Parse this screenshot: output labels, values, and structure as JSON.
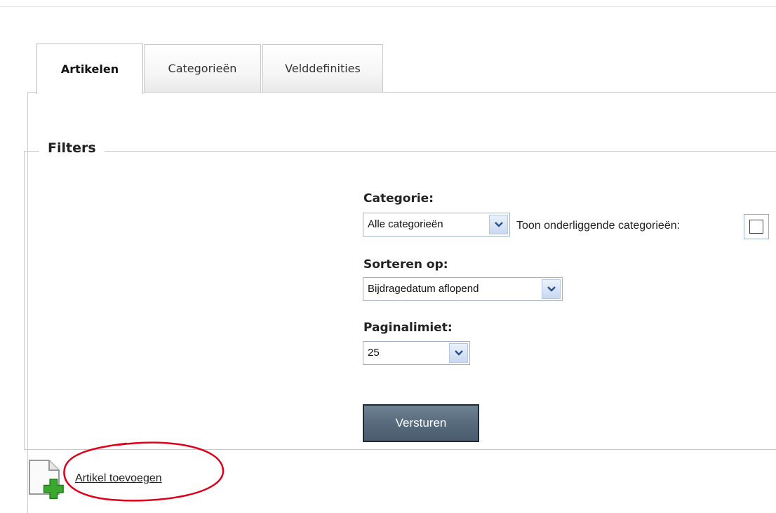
{
  "tabs": [
    {
      "label": "Artikelen",
      "active": true
    },
    {
      "label": "Categorieën",
      "active": false
    },
    {
      "label": "Velddefinities",
      "active": false
    }
  ],
  "filters": {
    "legend": "Filters",
    "category": {
      "label": "Categorie:",
      "selected": "Alle categorieën",
      "subcategories_label": "Toon onderliggende categorieën:",
      "subcategories_checked": false
    },
    "sort": {
      "label": "Sorteren op:",
      "selected": "Bijdragedatum aflopend"
    },
    "page_limit": {
      "label": "Paginalimiet:",
      "selected": "25"
    },
    "submit_label": "Versturen"
  },
  "actions": {
    "add_article": {
      "label": "Artikel toevoegen",
      "icon": "add-document-icon"
    }
  },
  "colors": {
    "annotation": "#e0001a",
    "submit_bg": "#5c6f80",
    "select_border": "#9fb2c7"
  }
}
